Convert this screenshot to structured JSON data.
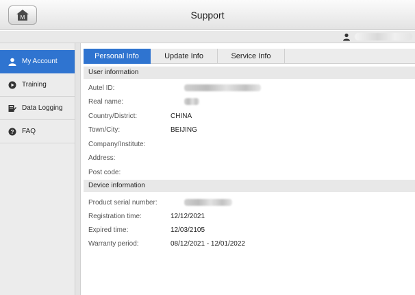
{
  "app": {
    "title": "Support",
    "home_badge": "M"
  },
  "user": {
    "name_redacted": true
  },
  "sidebar": {
    "items": [
      {
        "label": "My Account",
        "icon": "person-icon",
        "active": true
      },
      {
        "label": "Training",
        "icon": "play-circle-icon",
        "active": false
      },
      {
        "label": "Data Logging",
        "icon": "edit-note-icon",
        "active": false
      },
      {
        "label": "FAQ",
        "icon": "help-circle-icon",
        "active": false
      }
    ]
  },
  "tabs": [
    {
      "label": "Personal Info",
      "active": true
    },
    {
      "label": "Update Info",
      "active": false
    },
    {
      "label": "Service Info",
      "active": false
    }
  ],
  "user_information": {
    "header": "User information",
    "rows": [
      {
        "label": "Autel ID:",
        "value": "",
        "redacted": true
      },
      {
        "label": "Real name:",
        "value": "",
        "redacted": true
      },
      {
        "label": "Country/District:",
        "value": "CHINA"
      },
      {
        "label": "Town/City:",
        "value": "BEIJING"
      },
      {
        "label": "Company/Institute:",
        "value": ""
      },
      {
        "label": "Address:",
        "value": ""
      },
      {
        "label": "Post code:",
        "value": ""
      }
    ]
  },
  "device_information": {
    "header": "Device information",
    "rows": [
      {
        "label": "Product serial number:",
        "value": "",
        "redacted": true
      },
      {
        "label": "Registration time:",
        "value": "12/12/2021"
      },
      {
        "label": "Expired time:",
        "value": "12/03/2105"
      },
      {
        "label": "Warranty period:",
        "value": "08/12/2021 - 12/01/2022"
      }
    ]
  },
  "colors": {
    "accent": "#2f74d0",
    "sidebar_bg": "#ececec",
    "section_bg": "#e8e8e8"
  }
}
